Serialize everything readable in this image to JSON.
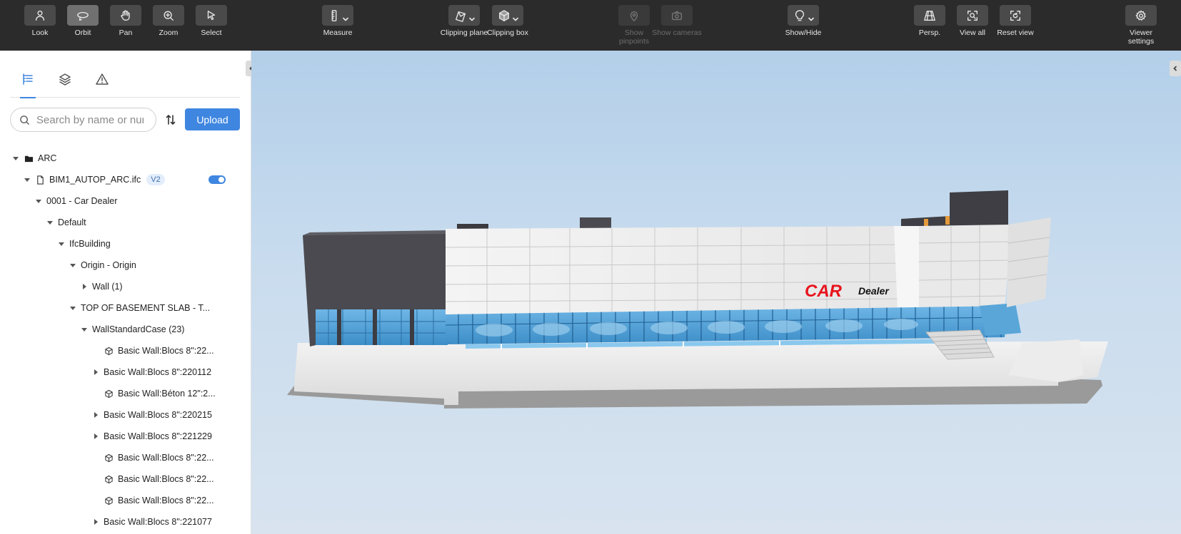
{
  "toolbar": {
    "look": "Look",
    "orbit": "Orbit",
    "pan": "Pan",
    "zoom": "Zoom",
    "select": "Select",
    "measure": "Measure",
    "clipping_plane": "Clipping plane",
    "clipping_box": "Clipping box",
    "show_pinpoints": "Show pinpoints",
    "show_cameras": "Show cameras",
    "show_hide": "Show/Hide",
    "persp": "Persp.",
    "view_all": "View all",
    "reset_view": "Reset view",
    "viewer_settings": "Viewer settings"
  },
  "sidebar": {
    "search_placeholder": "Search by name or number",
    "upload_label": "Upload",
    "tree": [
      {
        "label": "ARC"
      },
      {
        "label": "BIM1_AUTOP_ARC.ifc",
        "badge": "V2"
      },
      {
        "label": "0001 - Car Dealer"
      },
      {
        "label": "Default"
      },
      {
        "label": "IfcBuilding"
      },
      {
        "label": "Origin - Origin"
      },
      {
        "label": "Wall (1)"
      },
      {
        "label": "TOP OF BASEMENT SLAB - T..."
      },
      {
        "label": "WallStandardCase (23)"
      },
      {
        "label": "Basic Wall:Blocs 8\":22..."
      },
      {
        "label": "Basic Wall:Blocs 8\":220112"
      },
      {
        "label": "Basic Wall:Béton 12\":2..."
      },
      {
        "label": "Basic Wall:Blocs 8\":220215"
      },
      {
        "label": "Basic Wall:Blocs 8\":221229"
      },
      {
        "label": "Basic Wall:Blocs 8\":22..."
      },
      {
        "label": "Basic Wall:Blocs 8\":22..."
      },
      {
        "label": "Basic Wall:Blocs 8\":22..."
      },
      {
        "label": "Basic Wall:Blocs 8\":221077"
      }
    ]
  },
  "scene": {
    "sign_car": "CAR",
    "sign_dealer": "Dealer"
  },
  "colors": {
    "accent": "#3f86e0",
    "toolbar_bg": "#2b2b2b",
    "sign_red": "#e8141c"
  }
}
